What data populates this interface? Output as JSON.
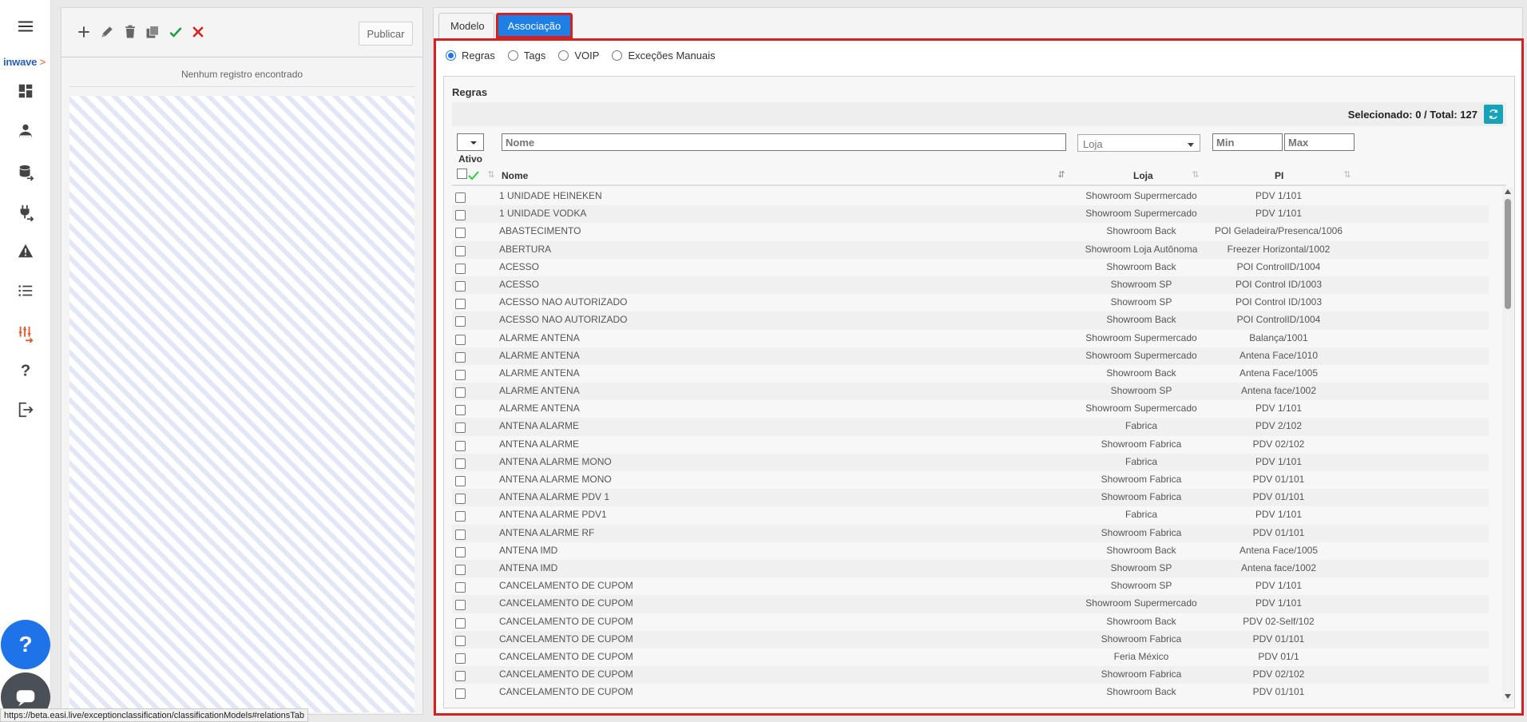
{
  "brand": {
    "name": "inwave",
    "arrow": ">"
  },
  "nav": {
    "items": [
      {
        "icon": "menu-icon"
      },
      {
        "icon": "dashboard-icon"
      },
      {
        "icon": "person-icon"
      },
      {
        "icon": "database-arrow-icon"
      },
      {
        "icon": "plug-arrow-icon"
      },
      {
        "icon": "warning-icon"
      },
      {
        "icon": "list-icon"
      },
      {
        "icon": "sliders-arrow-icon"
      },
      {
        "icon": "help-icon"
      },
      {
        "icon": "logout-icon"
      }
    ],
    "fab_help": "?",
    "accent": "#e3582c"
  },
  "left_panel": {
    "publish_label": "Publicar",
    "empty_text": "Nenhum registro encontrado"
  },
  "tabs": {
    "modelo": "Modelo",
    "associacao": "Associação"
  },
  "radios": {
    "regras": "Regras",
    "tags": "Tags",
    "voip": "VOIP",
    "excecoes": "Exceções Manuais",
    "selected": "regras"
  },
  "regras": {
    "title": "Regras",
    "selection_text": "Selecionado: 0 /  Total: 127",
    "filters": {
      "nome_placeholder": "Nome",
      "loja_placeholder": "Loja",
      "min_placeholder": "Min",
      "max_placeholder": "Max"
    },
    "headers": {
      "ativo": "Ativo",
      "nome": "Nome",
      "loja": "Loja",
      "pi": "PI"
    },
    "rows": [
      {
        "nome": "1 UNIDADE HEINEKEN",
        "loja": "Showroom Supermercado",
        "pi": "PDV 1/101"
      },
      {
        "nome": "1 UNIDADE VODKA",
        "loja": "Showroom Supermercado",
        "pi": "PDV 1/101"
      },
      {
        "nome": "ABASTECIMENTO",
        "loja": "Showroom Back",
        "pi": "POI Geladeira/Presenca/1006"
      },
      {
        "nome": "ABERTURA",
        "loja": "Showroom Loja Autônoma",
        "pi": "Freezer Horizontal/1002"
      },
      {
        "nome": "ACESSO",
        "loja": "Showroom Back",
        "pi": "POI ControlID/1004"
      },
      {
        "nome": "ACESSO",
        "loja": "Showroom SP",
        "pi": "POI Control ID/1003"
      },
      {
        "nome": "ACESSO NAO AUTORIZADO",
        "loja": "Showroom SP",
        "pi": "POI Control ID/1003"
      },
      {
        "nome": "ACESSO NAO AUTORIZADO",
        "loja": "Showroom Back",
        "pi": "POI ControlID/1004"
      },
      {
        "nome": "ALARME ANTENA",
        "loja": "Showroom Supermercado",
        "pi": "Balança/1001"
      },
      {
        "nome": "ALARME ANTENA",
        "loja": "Showroom Supermercado",
        "pi": "Antena Face/1010"
      },
      {
        "nome": "ALARME ANTENA",
        "loja": "Showroom Back",
        "pi": "Antena Face/1005"
      },
      {
        "nome": "ALARME ANTENA",
        "loja": "Showroom SP",
        "pi": "Antena face/1002"
      },
      {
        "nome": "ALARME ANTENA",
        "loja": "Showroom Supermercado",
        "pi": "PDV 1/101"
      },
      {
        "nome": "ANTENA ALARME",
        "loja": "Fabrica",
        "pi": "PDV 2/102"
      },
      {
        "nome": "ANTENA ALARME",
        "loja": "Showroom Fabrica",
        "pi": "PDV 02/102"
      },
      {
        "nome": "ANTENA ALARME MONO",
        "loja": "Fabrica",
        "pi": "PDV 1/101"
      },
      {
        "nome": "ANTENA ALARME MONO",
        "loja": "Showroom Fabrica",
        "pi": "PDV 01/101"
      },
      {
        "nome": "ANTENA ALARME PDV 1",
        "loja": "Showroom Fabrica",
        "pi": "PDV 01/101"
      },
      {
        "nome": "ANTENA ALARME PDV1",
        "loja": "Fabrica",
        "pi": "PDV 1/101"
      },
      {
        "nome": "ANTENA ALARME RF",
        "loja": "Showroom Fabrica",
        "pi": "PDV 01/101"
      },
      {
        "nome": "ANTENA IMD",
        "loja": "Showroom Back",
        "pi": "Antena Face/1005"
      },
      {
        "nome": "ANTENA IMD",
        "loja": "Showroom SP",
        "pi": "Antena face/1002"
      },
      {
        "nome": "CANCELAMENTO DE CUPOM",
        "loja": "Showroom SP",
        "pi": "PDV 1/101"
      },
      {
        "nome": "CANCELAMENTO DE CUPOM",
        "loja": "Showroom Supermercado",
        "pi": "PDV 1/101"
      },
      {
        "nome": "CANCELAMENTO DE CUPOM",
        "loja": "Showroom Back",
        "pi": "PDV 02-Self/102"
      },
      {
        "nome": "CANCELAMENTO DE CUPOM",
        "loja": "Showroom Fabrica",
        "pi": "PDV 01/101"
      },
      {
        "nome": "CANCELAMENTO DE CUPOM",
        "loja": "Feria México",
        "pi": "PDV 01/1"
      },
      {
        "nome": "CANCELAMENTO DE CUPOM",
        "loja": "Showroom Fabrica",
        "pi": "PDV 02/102"
      },
      {
        "nome": "CANCELAMENTO DE CUPOM",
        "loja": "Showroom Back",
        "pi": "PDV 01/101"
      }
    ]
  },
  "status_url": "https://beta.easi.live/exceptionclassification/classificationModels#relationsTab",
  "colors": {
    "tab_active": "#1e7fe6",
    "highlight_border": "#d32020",
    "refresh": "#17a2b8",
    "confirm": "#1a9e3a",
    "cancel": "#d32020"
  }
}
